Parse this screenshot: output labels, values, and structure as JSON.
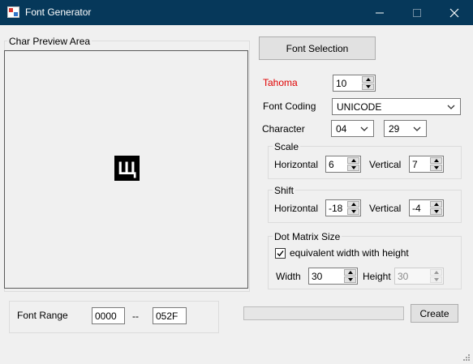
{
  "window": {
    "title": "Font Generator"
  },
  "preview": {
    "label": "Char Preview Area",
    "glyph": "Щ"
  },
  "font": {
    "selection_button": "Font Selection",
    "name": "Tahoma",
    "size": "10"
  },
  "coding": {
    "label": "Font Coding",
    "value": "UNICODE"
  },
  "character": {
    "label": "Character",
    "high": "04",
    "low": "29"
  },
  "scale": {
    "label": "Scale",
    "horizontal_label": "Horizontal",
    "horizontal": "6",
    "vertical_label": "Vertical",
    "vertical": "7"
  },
  "shift": {
    "label": "Shift",
    "horizontal_label": "Horizontal",
    "horizontal": "-18",
    "vertical_label": "Vertical",
    "vertical": "-4"
  },
  "dot_matrix": {
    "label": "Dot Matrix Size",
    "equivalent_label": "equivalent width with height",
    "equivalent_checked": true,
    "width_label": "Width",
    "width": "30",
    "height_label": "Height",
    "height": "30"
  },
  "range": {
    "label": "Font Range",
    "start": "0000",
    "separator": "--",
    "end": "052F"
  },
  "progress": {
    "value": 0
  },
  "actions": {
    "create": "Create"
  },
  "colors": {
    "titlebar": "#06385a",
    "font_name": "#e00000"
  }
}
